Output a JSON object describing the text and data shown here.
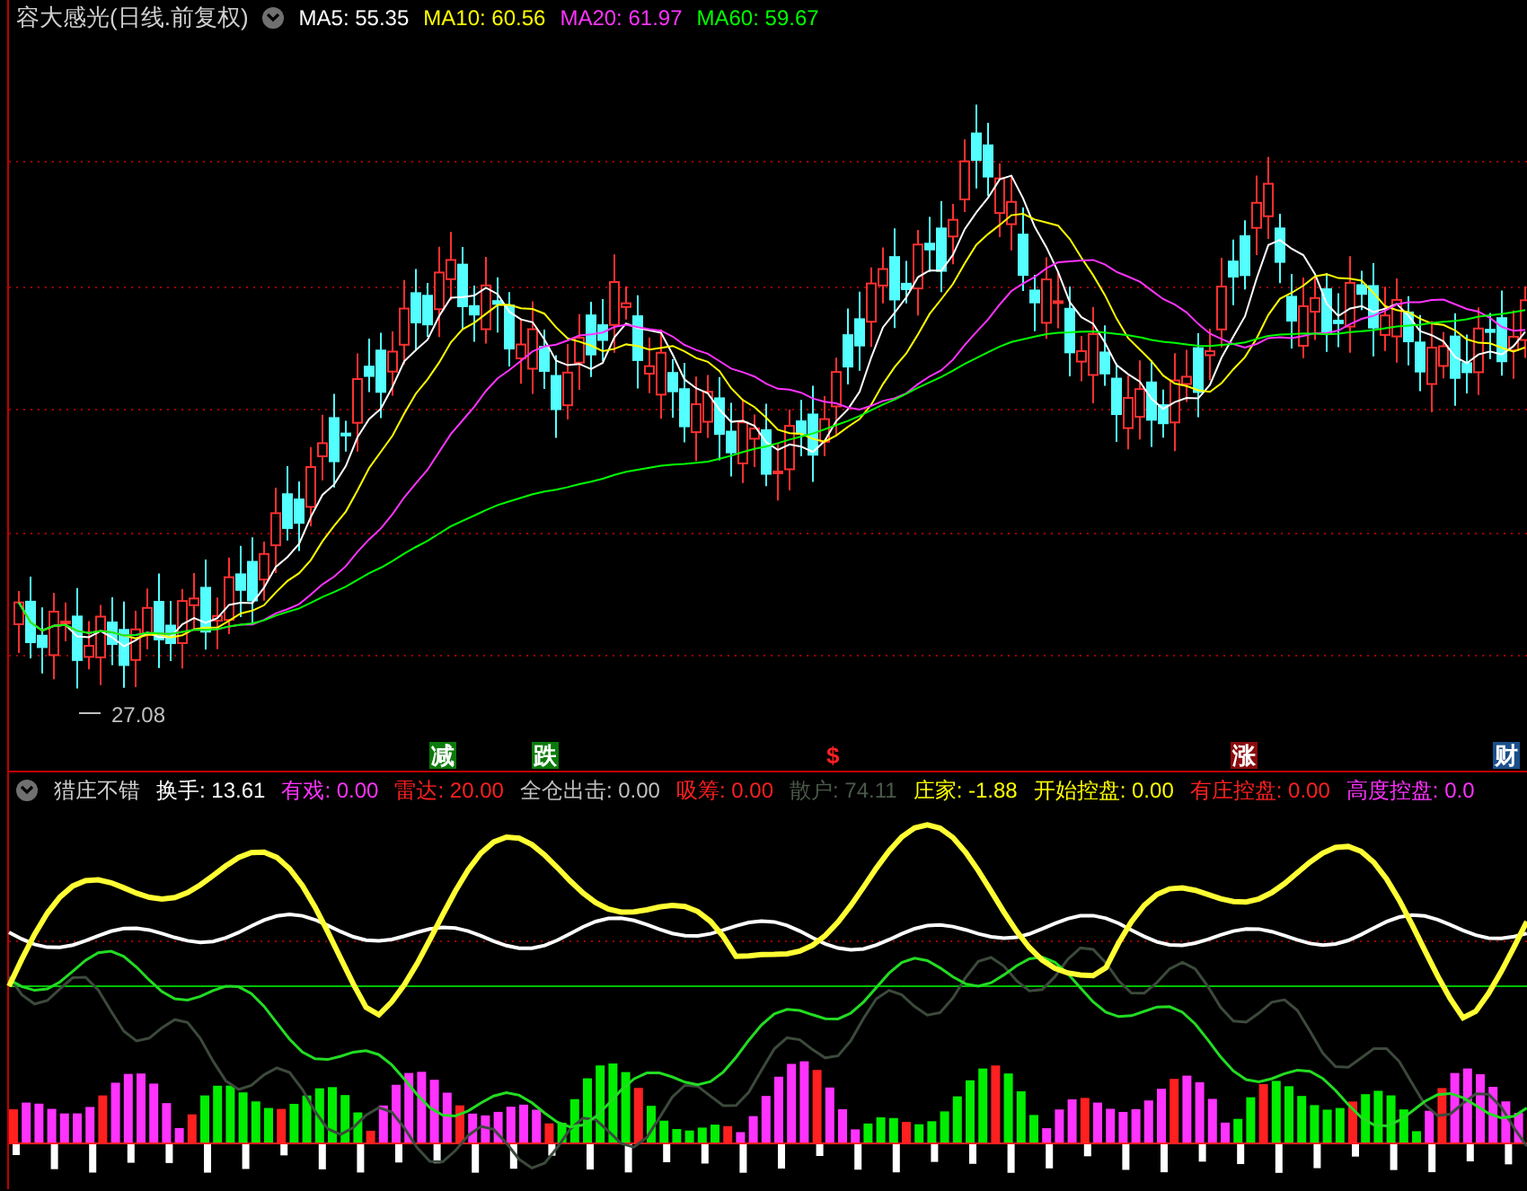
{
  "main_chart": {
    "title": "容大感光(日线.前复权)",
    "legend": [
      {
        "text": "MA5: 55.35",
        "color": "#ffffff"
      },
      {
        "text": "MA10: 60.56",
        "color": "#ffff00"
      },
      {
        "text": "MA20: 61.97",
        "color": "#ff33ff"
      },
      {
        "text": "MA60: 59.67",
        "color": "#00ff00"
      }
    ],
    "price_label": "27.08"
  },
  "markers": [
    {
      "label": "减",
      "kind": "box",
      "color": "#0b7a0b"
    },
    {
      "label": "跌",
      "kind": "box",
      "color": "#0b7a0b"
    },
    {
      "label": "$",
      "kind": "plain",
      "color": "#ff2020"
    },
    {
      "label": "涨",
      "kind": "box",
      "color": "#8a0c0c"
    },
    {
      "label": "财",
      "kind": "box",
      "color": "#1a4f8a"
    }
  ],
  "indicator": {
    "title": "猎庄不错",
    "readings": [
      {
        "text": "换手: 13.61",
        "color": "#ffffff"
      },
      {
        "text": "有戏: 0.00",
        "color": "#ff33ff"
      },
      {
        "text": "雷达: 20.00",
        "color": "#ff2020"
      },
      {
        "text": "全仓出击: 0.00",
        "color": "#c0c0c0"
      },
      {
        "text": "吸筹: 0.00",
        "color": "#ff2020"
      },
      {
        "text": "散户: 74.11",
        "color": "#4a5a4a"
      },
      {
        "text": "庄家: -1.88",
        "color": "#ffff00"
      },
      {
        "text": "开始控盘: 0.00",
        "color": "#ffff00"
      },
      {
        "text": "有庄控盘: 0.00",
        "color": "#ff2020"
      },
      {
        "text": "高度控盘: 0.0",
        "color": "#ff33ff"
      }
    ]
  }
}
